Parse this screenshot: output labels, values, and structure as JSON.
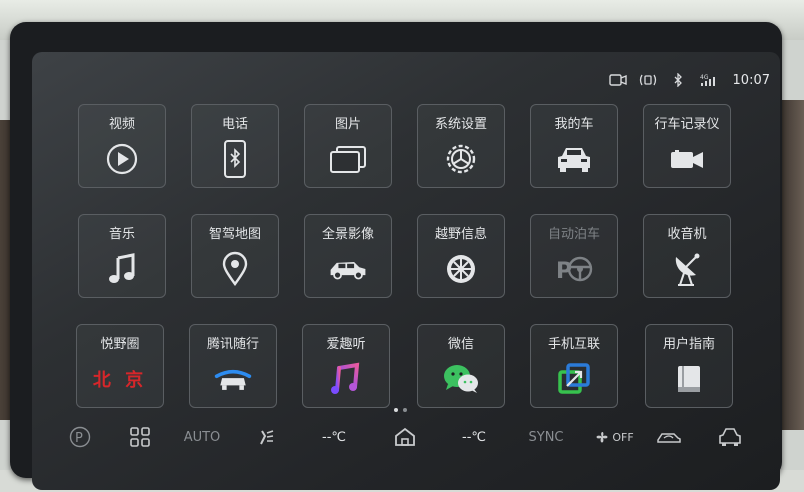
{
  "status": {
    "time": "10:07",
    "icons": [
      "camera-icon",
      "wireless-icon",
      "bluetooth-icon",
      "4g-signal-icon"
    ],
    "network": "4G"
  },
  "apps": [
    {
      "label": "视频",
      "icon": "play-icon"
    },
    {
      "label": "电话",
      "icon": "phone-bluetooth-icon"
    },
    {
      "label": "图片",
      "icon": "photos-icon"
    },
    {
      "label": "系统设置",
      "icon": "settings-gear-icon"
    },
    {
      "label": "我的车",
      "icon": "my-car-icon"
    },
    {
      "label": "行车记录仪",
      "icon": "dashcam-icon"
    },
    {
      "label": "音乐",
      "icon": "music-note-icon"
    },
    {
      "label": "智驾地图",
      "icon": "map-pin-icon"
    },
    {
      "label": "全景影像",
      "icon": "suv-icon"
    },
    {
      "label": "越野信息",
      "icon": "wheel-icon"
    },
    {
      "label": "自动泊车",
      "icon": "auto-parking-icon",
      "disabled": true
    },
    {
      "label": "收音机",
      "icon": "radio-antenna-icon"
    },
    {
      "label": "悦野圈",
      "icon": "beijing-logo-icon",
      "logo_text": "北 京"
    },
    {
      "label": "腾讯随行",
      "icon": "tencent-car-icon"
    },
    {
      "label": "爱趣听",
      "icon": "aiquting-music-icon"
    },
    {
      "label": "微信",
      "icon": "wechat-icon"
    },
    {
      "label": "手机互联",
      "icon": "phone-link-icon"
    },
    {
      "label": "用户指南",
      "icon": "user-guide-book-icon"
    }
  ],
  "pager": {
    "count": 2,
    "active": 0
  },
  "dock": {
    "auto_label": "AUTO",
    "temp_left": "--℃",
    "temp_right": "--℃",
    "sync_label": "SYNC",
    "fan_label": "OFF",
    "icons": [
      "parking-p-icon",
      "apps-grid-icon",
      "seat-airflow-icon",
      "home-icon",
      "fan-icon",
      "car-recirculation-icon",
      "car-front-defrost-icon"
    ]
  },
  "colors": {
    "screen_bg": "#2d3033",
    "tile_border": "#5a5e62",
    "text": "#e4e6e8",
    "wechat_green": "#3cc160",
    "beijing_red": "#d7262a",
    "tencent_blue": "#2d8cf0",
    "phonelink_green": "#37c24e",
    "phonelink_blue": "#2b7bd8"
  }
}
